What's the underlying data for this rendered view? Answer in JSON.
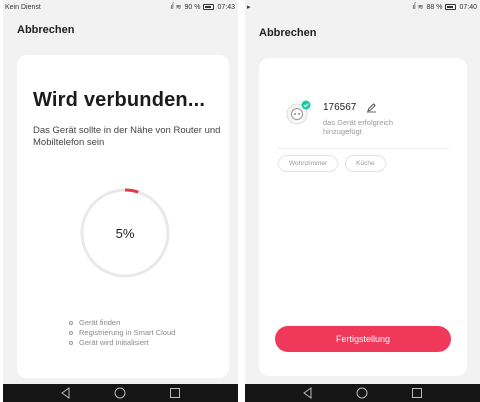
{
  "left_screen": {
    "statusbar": {
      "carrier": "Kein Dienst",
      "battery": "90 %",
      "time": "07:43"
    },
    "cancel": "Abbrechen",
    "title": "Wird verbunden...",
    "description": "Das Gerät sollte in der Nähe von Router und Mobiltelefon sein",
    "progress_percent": 5,
    "progress_label": "5%",
    "accent_color": "#e8394a",
    "steps": [
      "Gerät finden",
      "Registrierung in Smart Cloud",
      "Gerät wird initialisiert"
    ]
  },
  "right_screen": {
    "statusbar": {
      "battery": "88 %",
      "time": "07:40"
    },
    "cancel": "Abbrechen",
    "device": {
      "icon": "smart-plug-icon",
      "name": "176567",
      "status": "das Gerät erfolgreich hinzugefügt",
      "check_color": "#1bc8a0"
    },
    "rooms": [
      "Wohnzimmer",
      "Küche"
    ],
    "finish_button": "Fertigstellung",
    "button_color": "#f0385a"
  }
}
